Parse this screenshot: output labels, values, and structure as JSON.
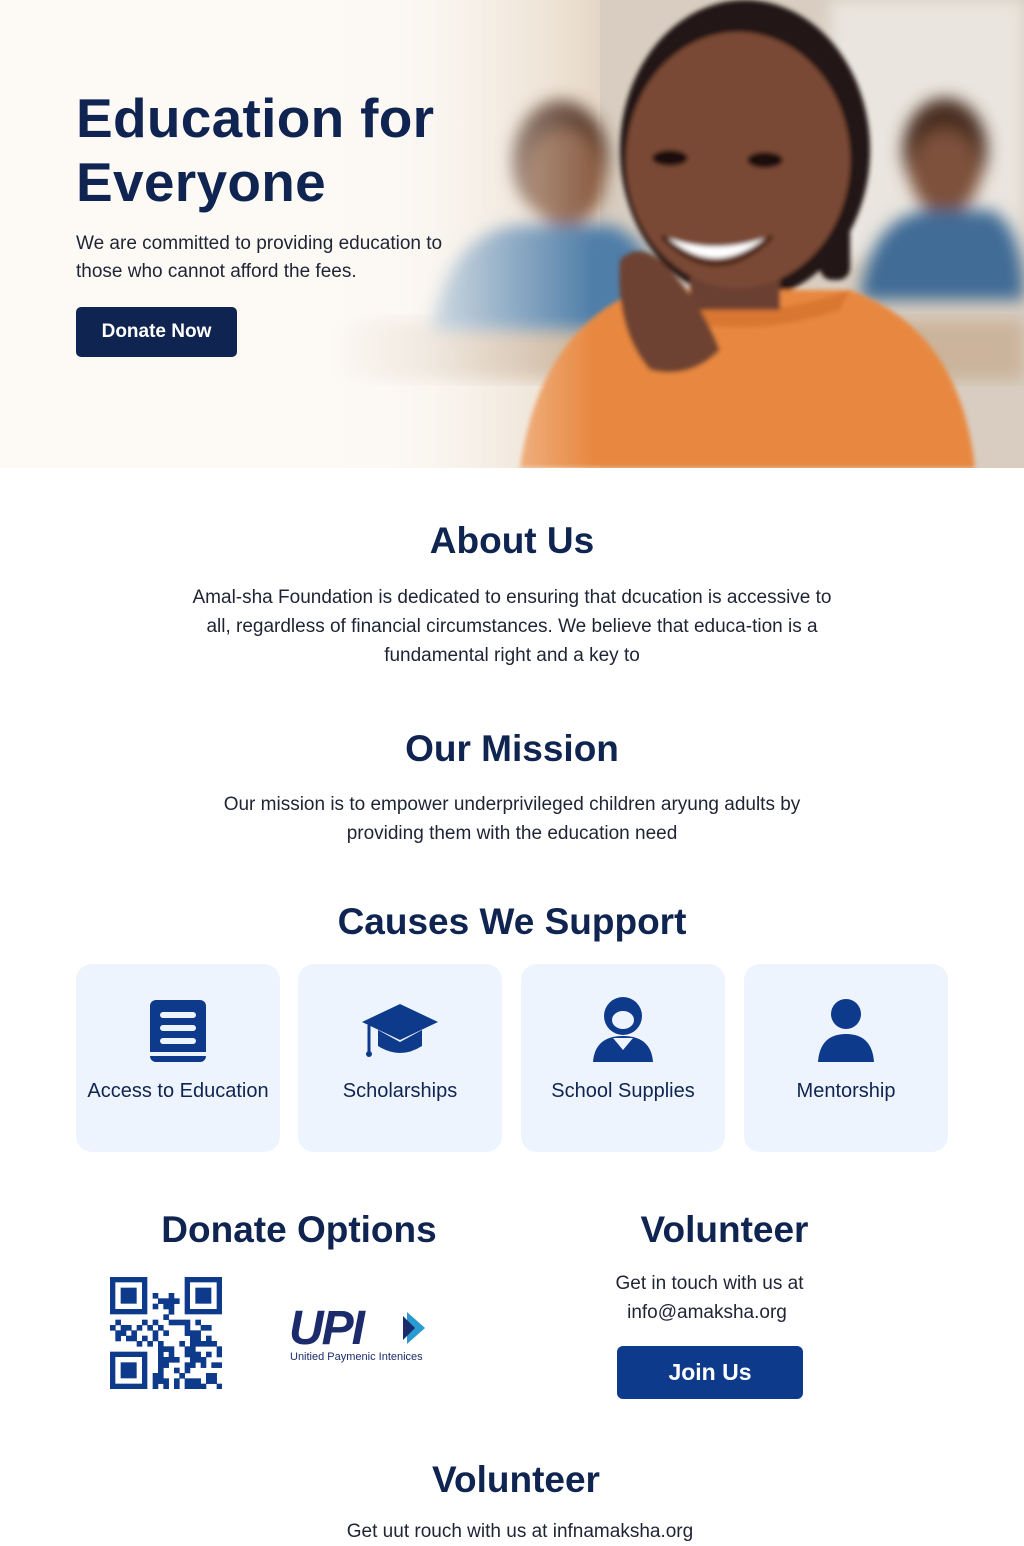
{
  "hero": {
    "title": "Education for\nEveryone",
    "text": "We are committed to providing education to those who cannot afford the fees.",
    "cta_label": "Donate Now"
  },
  "about": {
    "title": "About Us",
    "text": "Amal-sha Foundation is dedicated to ensuring that dcucation is accessive to all, regardless of financial circumstances. We believe that educa-tion is a fundamental right and a key to"
  },
  "mission": {
    "title": "Our Mission",
    "text": "Our mission is to empower underprivileged children aryung adults by providing them with the education need"
  },
  "causes": {
    "title": "Causes We Support",
    "items": [
      {
        "label": "Access to Education",
        "icon": "book-icon"
      },
      {
        "label": "Scholarships",
        "icon": "graduation-cap-icon"
      },
      {
        "label": "School Supplies",
        "icon": "student-icon"
      },
      {
        "label": "Mentorship",
        "icon": "person-icon"
      }
    ]
  },
  "donate": {
    "title": "Donate Options",
    "upi_logo": "UPI",
    "upi_caption": "Unitied Paymenic Intenices"
  },
  "volunteer": {
    "title": "Volunteer",
    "line1": "Get in touch with us at",
    "email": "info@amaksha.org",
    "join_label": "Join Us"
  },
  "volunteer2": {
    "title": "Volunteer",
    "text": "Get uut rouch with us at infnamaksha.org"
  },
  "colors": {
    "primary": "#0f2450",
    "accent": "#0e3a8c",
    "card_bg": "#eef4fd",
    "tshirt": "#e8883f"
  }
}
